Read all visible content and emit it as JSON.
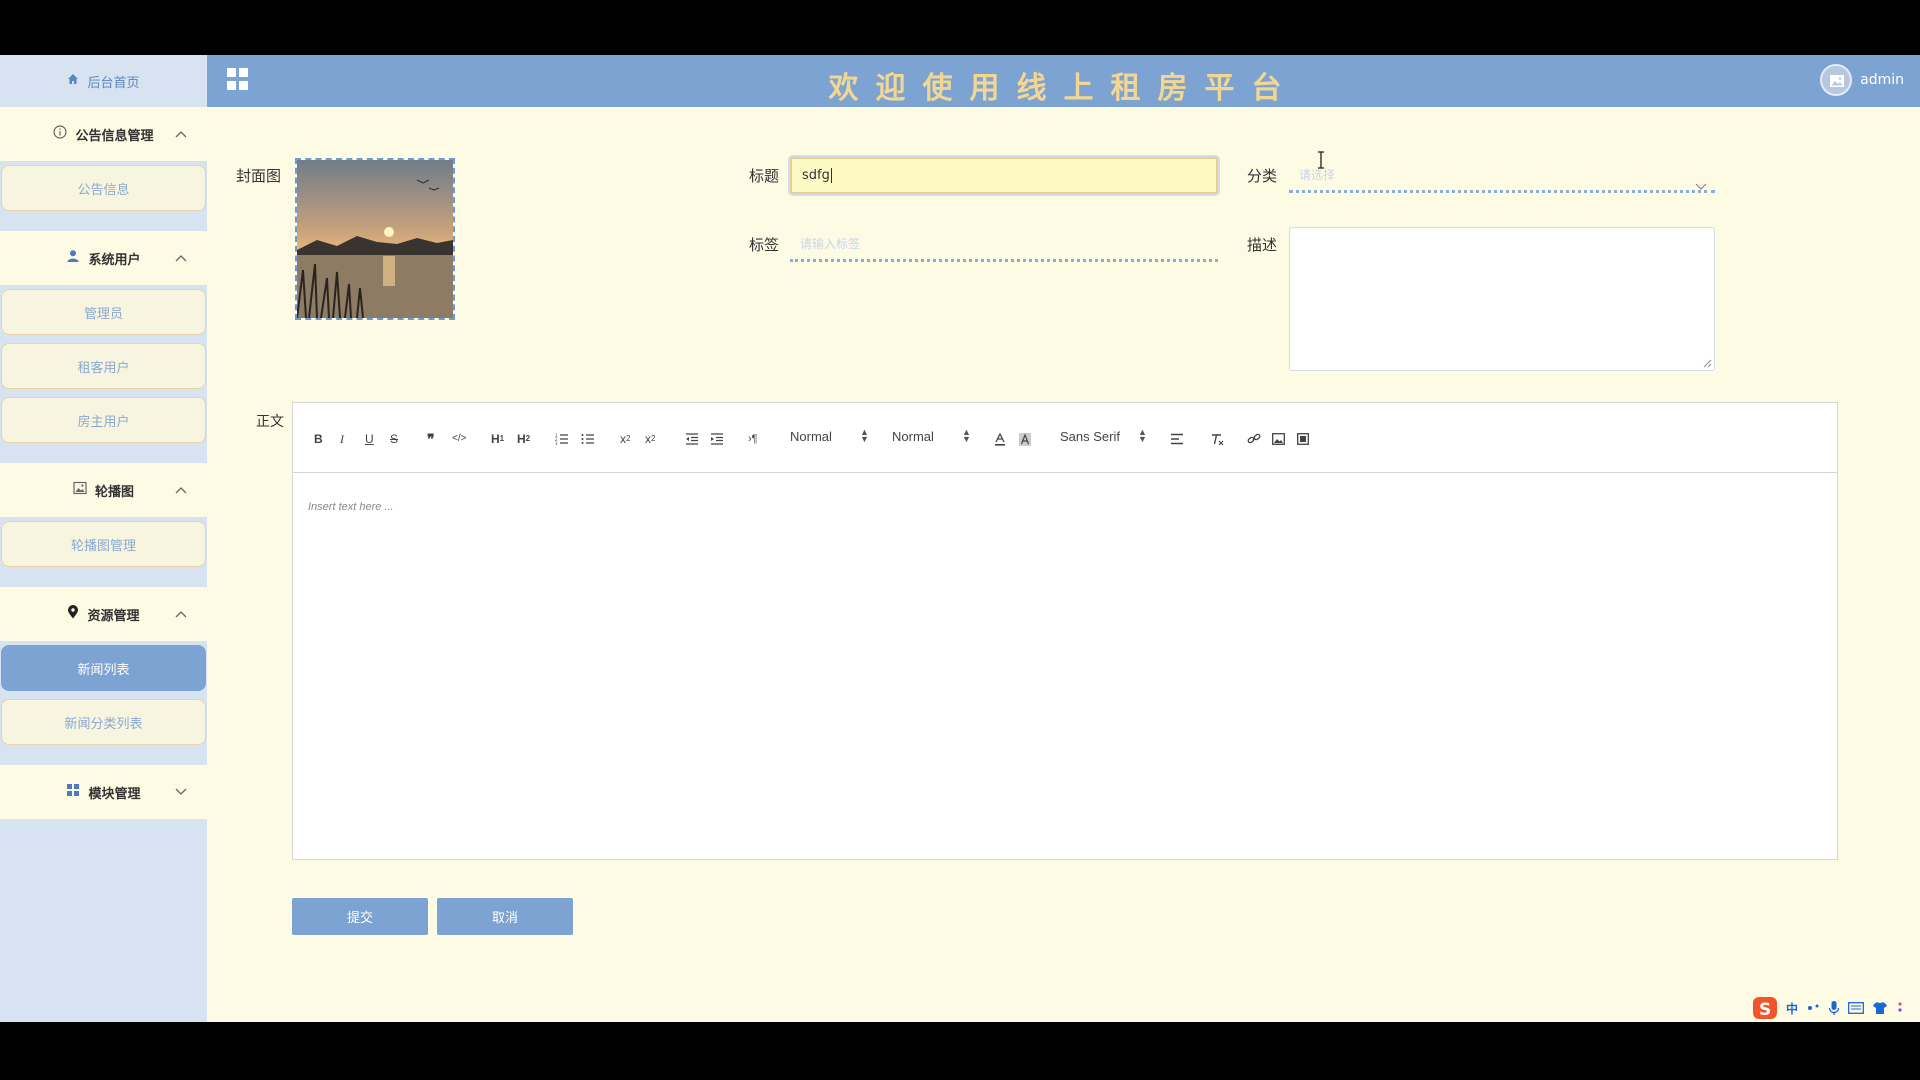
{
  "header": {
    "title": "欢迎使用线上租房平台",
    "username": "admin"
  },
  "sidebar": {
    "home": "后台首页",
    "groups": [
      {
        "label": "公告信息管理",
        "icon": "info-circle-icon",
        "expanded": true,
        "items": [
          {
            "label": "公告信息"
          }
        ]
      },
      {
        "label": "系统用户",
        "icon": "user-icon",
        "expanded": true,
        "items": [
          {
            "label": "管理员"
          },
          {
            "label": "租客用户"
          },
          {
            "label": "房主用户"
          }
        ]
      },
      {
        "label": "轮播图",
        "icon": "image-icon",
        "expanded": true,
        "items": [
          {
            "label": "轮播图管理"
          }
        ]
      },
      {
        "label": "资源管理",
        "icon": "location-pin-icon",
        "expanded": true,
        "items": [
          {
            "label": "新闻列表",
            "active": true
          },
          {
            "label": "新闻分类列表"
          }
        ]
      },
      {
        "label": "模块管理",
        "icon": "grid-icon",
        "expanded": false,
        "items": []
      }
    ]
  },
  "form": {
    "cover_label": "封面图",
    "title_label": "标题",
    "title_value": "sdfg",
    "category_label": "分类",
    "category_placeholder": "请选择",
    "tags_label": "标签",
    "tags_placeholder": "请输入标签",
    "desc_label": "描述",
    "body_label": "正文",
    "body_placeholder": "Insert text here ...",
    "submit_label": "提交",
    "cancel_label": "取消"
  },
  "editor_toolbar": {
    "header_select": "Normal",
    "size_select": "Normal",
    "font_select": "Sans Serif"
  },
  "ime": {
    "lang": "中"
  },
  "colors": {
    "accent": "#7ca3d1",
    "background": "#fdfbe4",
    "sidebar": "#d7e3f1",
    "title_text": "#f4d693"
  }
}
